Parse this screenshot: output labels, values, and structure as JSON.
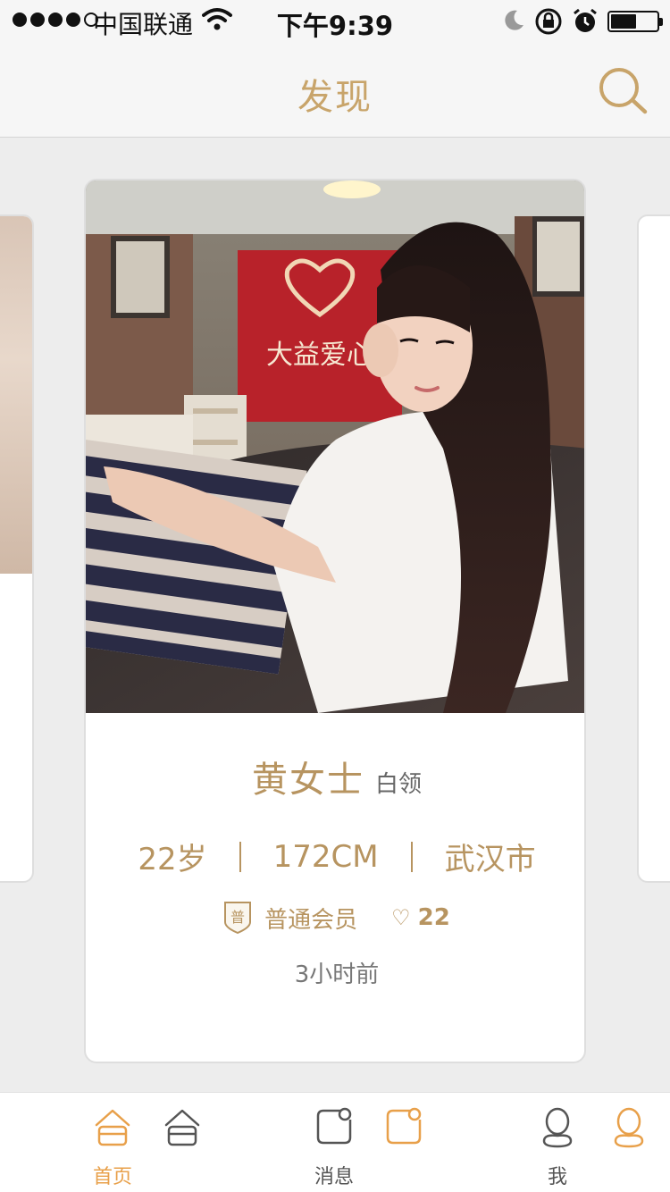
{
  "status_bar": {
    "carrier": "中国联通",
    "time": "下午9:39"
  },
  "nav": {
    "title": "发现"
  },
  "profile": {
    "name": "黄女士",
    "occupation": "白领",
    "age": "22岁",
    "height": "172CM",
    "city": "武汉市",
    "badge_glyph": "普",
    "membership": "普通会员",
    "likes": "22",
    "last_active": "3小时前",
    "photo_sign_text": "大益爱心"
  },
  "tab_bar": {
    "tabs": [
      {
        "label": "首页",
        "state": "active",
        "icon": "home-icon"
      },
      {
        "label": "消息",
        "state": "inactive",
        "icon": "message-icon"
      },
      {
        "label": "我",
        "state": "inactive",
        "icon": "profile-icon"
      }
    ]
  },
  "colors": {
    "accent_gold": "#b79460",
    "nav_title": "#c8a46a",
    "tab_active": "#e8a04a",
    "background": "#ededed"
  }
}
